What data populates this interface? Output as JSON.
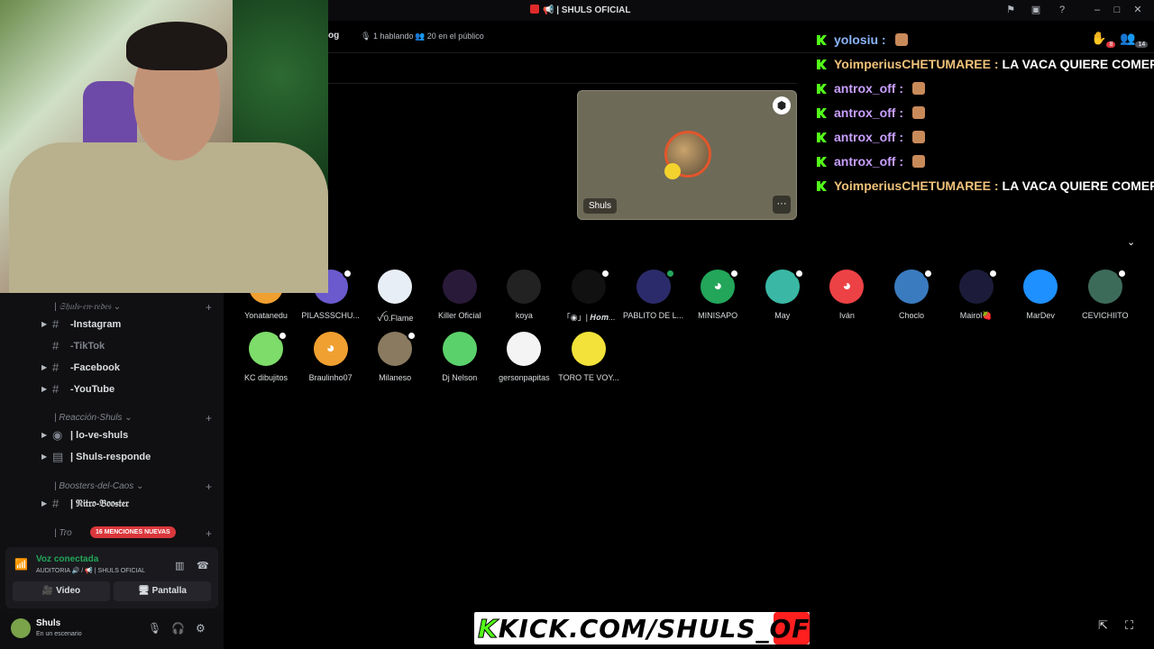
{
  "window": {
    "title": "📢 | SHULS OFICIAL",
    "controls": [
      "flag-icon",
      "inbox-icon",
      "help-icon",
      "minimize-icon",
      "maximize-icon",
      "close-icon"
    ]
  },
  "stage": {
    "title_fragment": "og",
    "speaking": "1 hablando",
    "audience": "20 en el público",
    "speaker": {
      "name": "Shuls"
    }
  },
  "chat": [
    {
      "user": "yolosiu :",
      "message": "",
      "color": "#8ab4f8",
      "emote": true
    },
    {
      "user": "YoimperiusCHETUMAREE :",
      "message": "LA VACA QUIERE COMER",
      "color": "#f0c27a",
      "emote": false
    },
    {
      "user": "antrox_off :",
      "message": "",
      "color": "#c9a0ff",
      "emote": true
    },
    {
      "user": "antrox_off :",
      "message": "",
      "color": "#c9a0ff",
      "emote": true
    },
    {
      "user": "antrox_off :",
      "message": "",
      "color": "#c9a0ff",
      "emote": true
    },
    {
      "user": "antrox_off :",
      "message": "",
      "color": "#c9a0ff",
      "emote": true
    },
    {
      "user": "YoimperiusCHETUMAREE :",
      "message": "LA VACA QUIERE COMER",
      "color": "#f0c27a",
      "emote": false
    }
  ],
  "top_icons": {
    "hand_count": "8",
    "people_count": "14"
  },
  "audience_members": [
    {
      "name": "Yonatanedu",
      "color": "#f0a030",
      "glyph": "",
      "dot": "none"
    },
    {
      "name": "PILASSSCHU...",
      "color": "#6a5acd",
      "glyph": "",
      "dot": "white"
    },
    {
      "name": "ꪜ'0.Flame",
      "color": "#e8eef5",
      "glyph": "",
      "dot": "none"
    },
    {
      "name": "Killer Oficial",
      "color": "#2a1a3a",
      "glyph": "",
      "dot": "none"
    },
    {
      "name": "koya",
      "color": "#222222",
      "glyph": "",
      "dot": "none"
    },
    {
      "name": "「◉」| 𝑯𝒐𝒎...",
      "color": "#111111",
      "glyph": "",
      "dot": "white"
    },
    {
      "name": "PABLITO DE L...",
      "color": "#2b2b6b",
      "glyph": "",
      "dot": "green"
    },
    {
      "name": "MINISAPO",
      "color": "#23a55a",
      "glyph": "◕",
      "dot": "white"
    },
    {
      "name": "May",
      "color": "#3ab8a5",
      "glyph": "",
      "dot": "white"
    },
    {
      "name": "Iván",
      "color": "#ed4245",
      "glyph": "◕",
      "dot": "none"
    },
    {
      "name": "Choclo",
      "color": "#3a7bbf",
      "glyph": "",
      "dot": "white"
    },
    {
      "name": "Mairol🍓",
      "color": "#1c1c3a",
      "glyph": "",
      "dot": "white"
    },
    {
      "name": "MarDev",
      "color": "#1e90ff",
      "glyph": "",
      "dot": "none"
    },
    {
      "name": "CEVICHIITO",
      "color": "#3d6b5a",
      "glyph": "",
      "dot": "white"
    },
    {
      "name": "KC dibujitos",
      "color": "#7ddc6a",
      "glyph": "",
      "dot": "white"
    },
    {
      "name": "Braulinho07",
      "color": "#f0a030",
      "glyph": "◕",
      "dot": "none"
    },
    {
      "name": "Milaneso",
      "color": "#8a7a60",
      "glyph": "",
      "dot": "white"
    },
    {
      "name": "Dj Nelson",
      "color": "#5bd16b",
      "glyph": "",
      "dot": "none"
    },
    {
      "name": "gersonpapitas",
      "color": "#f4f4f4",
      "glyph": "",
      "dot": "none"
    },
    {
      "name": "TORO TE VOY...",
      "color": "#f2e23a",
      "glyph": "",
      "dot": "none"
    }
  ],
  "sidebar": {
    "groups": [
      {
        "label": "| 𝔖𝔥𝔲𝔩𝔰-𝔢𝔫-𝔯𝔢𝔡𝔢𝔰"
      },
      {
        "label": "| Reacción-Shuls"
      },
      {
        "label": "| Boosters-del-Caos"
      },
      {
        "label": "| Tro"
      }
    ],
    "channels": [
      {
        "label": "-Instagram",
        "muted": false
      },
      {
        "label": "-TikTok",
        "muted": true
      },
      {
        "label": "-Facebook",
        "muted": false
      },
      {
        "label": "-YouTube",
        "muted": false
      },
      {
        "label": "| lo-ve-shuls",
        "muted": false
      },
      {
        "label": "| Shuls-responde",
        "muted": false
      },
      {
        "label": "| 𝔑𝔦𝔱𝔯𝔬-𝔅𝔬𝔬𝔰𝔱𝔢𝔯",
        "muted": false
      }
    ],
    "mentions_badge": "16 MENCIONES NUEVAS"
  },
  "voice": {
    "status": "Voz conectada",
    "channel": "AUDITORIA 🔊 / 📢 | SHULS OFICIAL",
    "video_label": "Video",
    "screen_label": "Pantalla"
  },
  "user": {
    "name": "Shuls",
    "status": "En un escenario"
  },
  "banner": {
    "prefix": "K",
    "text": "KICK.COM/SHULS_OFF"
  }
}
